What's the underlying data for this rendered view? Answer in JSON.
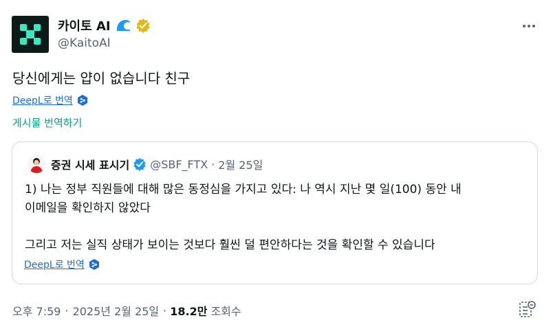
{
  "author": {
    "display_name": "카이토 AI",
    "handle": "@KaitoAI"
  },
  "tweet": {
    "text": "당신에게는 얍이 없습니다 친구",
    "deepl_label": "DeepL로 번역",
    "translate_post_label": "게시물 번역하기"
  },
  "quote": {
    "display_name": "증권 시세 표시기",
    "handle": "@SBF_FTX",
    "separator": "·",
    "date": "2월 25일",
    "line1": "1) 나는 정부 직원들에 대해 많은 동정심을 가지고 있다: 나 역시 지난 몇 일(100) 동안 내",
    "line2": "이메일을 확인하지 않았다",
    "line3": "그리고 저는 실직 상태가 보이는 것보다 훨씬 덜 편안하다는 것을 확인할 수 있습니다",
    "deepl_label": "DeepL로 번역"
  },
  "meta": {
    "time": "오후 7:59",
    "sep1": "·",
    "date": "2025년 2월 25일",
    "sep2": "·",
    "views_count": "18.2만",
    "views_label": "조회수"
  },
  "colors": {
    "link": "#1d6fd8",
    "translate": "#00a38a",
    "verified_gold": "#e2b719",
    "verified_blue": "#1d9bf0",
    "kaito_green": "#3be6c4"
  },
  "icons": [
    "kaito-logo-icon",
    "wave-badge-icon",
    "gold-verified-icon",
    "more-options-icon",
    "deepl-icon",
    "blue-verified-icon",
    "bookmark-icon"
  ]
}
